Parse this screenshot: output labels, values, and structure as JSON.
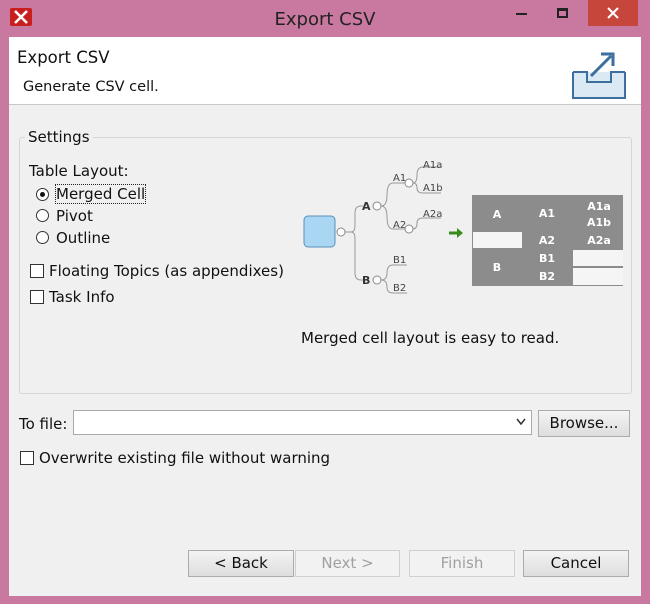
{
  "window": {
    "title": "Export CSV",
    "accent_color": "#c9789f",
    "close_color": "#c7463c",
    "app_icon": "xmind-x-icon"
  },
  "banner": {
    "title": "Export CSV",
    "subtitle": "Generate CSV cell.",
    "icon": "export-tray-icon"
  },
  "settings": {
    "legend": "Settings",
    "table_layout_label": "Table Layout:",
    "layouts": [
      {
        "label": "Merged Cell",
        "selected": true
      },
      {
        "label": "Pivot",
        "selected": false
      },
      {
        "label": "Outline",
        "selected": false
      }
    ],
    "options": [
      {
        "label": "Floating Topics (as appendixes)",
        "checked": false
      },
      {
        "label": "Task Info",
        "checked": false
      }
    ],
    "preview": {
      "tree": {
        "branch_a": "A",
        "branch_b": "B",
        "a1": "A1",
        "a1a": "A1a",
        "a1b": "A1b",
        "a2": "A2",
        "a2a": "A2a",
        "b1": "B1",
        "b2": "B2"
      },
      "table": {
        "col_a": "A",
        "col_a1": "A1",
        "col_a1ab_top": "A1a",
        "col_a1ab_bottom": "A1b",
        "col_a2": "A2",
        "col_a2a": "A2a",
        "col_b": "B",
        "col_b1": "B1",
        "col_b2": "B2"
      },
      "caption": "Merged cell layout is easy to read."
    }
  },
  "file": {
    "label": "To file:",
    "value": "",
    "browse_label": "Browse...",
    "overwrite_label": "Overwrite existing file without warning",
    "overwrite_checked": false
  },
  "buttons": {
    "back": "< Back",
    "next": "Next >",
    "finish": "Finish",
    "cancel": "Cancel"
  }
}
